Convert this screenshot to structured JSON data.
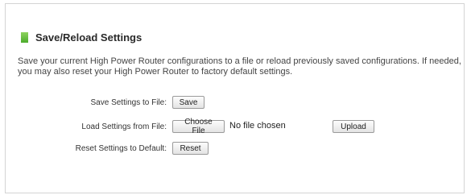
{
  "section": {
    "title": "Save/Reload Settings",
    "description": "Save your current High Power Router configurations to a file or reload previously saved configurations. If needed, you may also reset your High Power Router to factory default settings."
  },
  "save_row": {
    "label": "Save Settings to File:",
    "button": "Save"
  },
  "load_row": {
    "label": "Load Settings from File:",
    "choose_button": "Choose File",
    "file_status": "No file chosen",
    "upload_button": "Upload"
  },
  "reset_row": {
    "label": "Reset Settings to Default:",
    "button": "Reset"
  }
}
